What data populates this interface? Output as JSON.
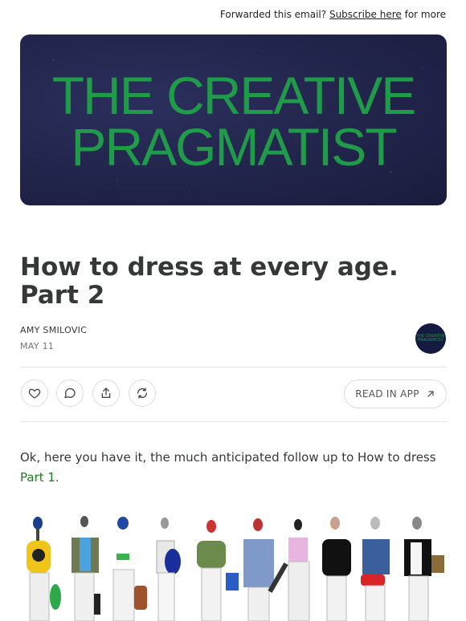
{
  "topbar": {
    "prefix": "Forwarded this email?",
    "link": "Subscribe here",
    "suffix": "for more"
  },
  "banner": {
    "line1": "THE CREATIVE",
    "line2": "PRAGMATIST"
  },
  "post": {
    "title": "How to dress at every age. Part 2",
    "author": "AMY SMILOVIC",
    "date": "MAY 11",
    "publication_logo_text": "THE CREATIVE PRAGMATIST"
  },
  "actions": {
    "read_in_app": "READ IN APP"
  },
  "body": {
    "intro": "Ok, here you have it, the much anticipated follow up to How to dress",
    "link": "Part 1."
  },
  "colors": {
    "banner_bg": "#23264d",
    "banner_text": "#1f9b4a",
    "link_green": "#1e7a1e"
  }
}
